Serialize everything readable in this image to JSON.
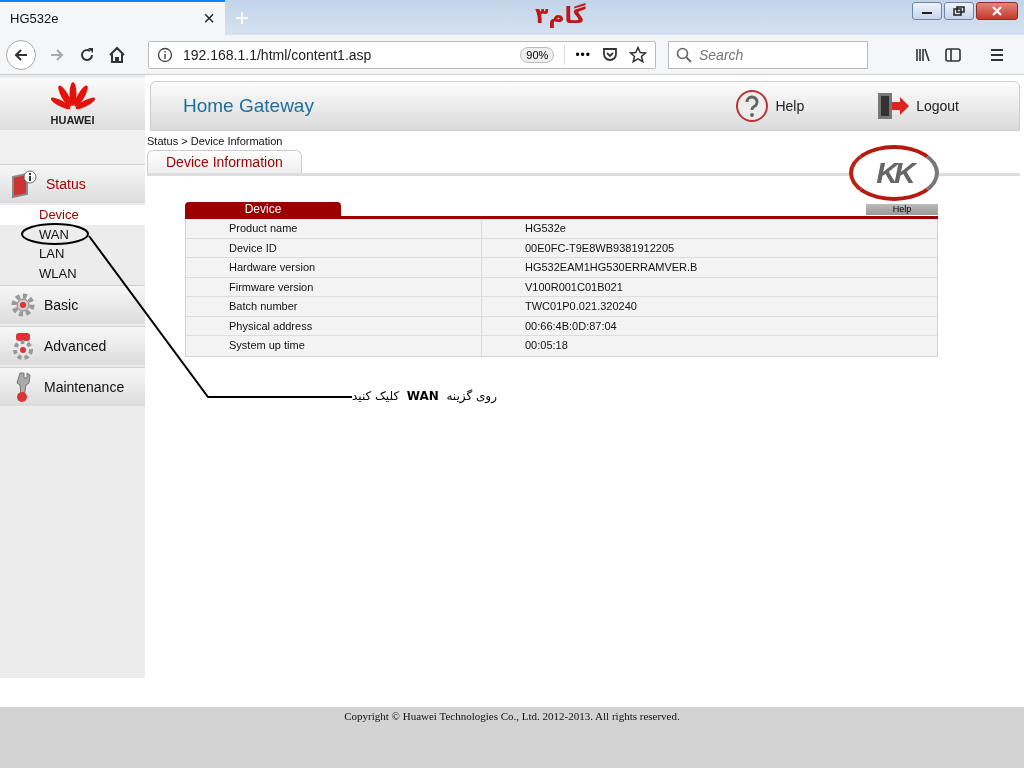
{
  "browser": {
    "tab": {
      "title": "HG532e",
      "close": "×"
    },
    "new_tab": "+",
    "url": "192.168.1.1/html/content1.asp",
    "zoom": "90%",
    "more": "•••",
    "search": {
      "placeholder": "Search"
    }
  },
  "overlay_title": "گام۳",
  "sidebar": {
    "logo_text": "HUAWEI",
    "sections": [
      {
        "label": "Status",
        "selected": true,
        "expanded": true,
        "children": [
          {
            "label": "Device",
            "selected": true
          },
          {
            "label": "WAN",
            "selected": false
          },
          {
            "label": "LAN",
            "selected": false
          },
          {
            "label": "WLAN",
            "selected": false
          }
        ]
      },
      {
        "label": "Basic",
        "selected": false,
        "expanded": false
      },
      {
        "label": "Advanced",
        "selected": false,
        "expanded": false
      },
      {
        "label": "Maintenance",
        "selected": false,
        "expanded": false
      }
    ]
  },
  "header": {
    "title": "Home Gateway",
    "help": "Help",
    "logout": "Logout"
  },
  "breadcrumb": "Status > Device Information",
  "tabs": [
    {
      "label": "Device Information",
      "selected": true
    }
  ],
  "corner_logo": "KK",
  "device_table": {
    "title": "Device",
    "help": "Help",
    "rows": [
      {
        "label": "Product name",
        "value": "HG532e"
      },
      {
        "label": "Device ID",
        "value": "00E0FC-T9E8WB9381912205"
      },
      {
        "label": "Hardware version",
        "value": "HG532EAM1HG530ERRAMVER.B"
      },
      {
        "label": "Firmware version",
        "value": "V100R001C01B021"
      },
      {
        "label": "Batch number",
        "value": "TWC01P0.021.320240"
      },
      {
        "label": "Physical address",
        "value": "00:66:4B:0D:87:04"
      },
      {
        "label": "System up time",
        "value": "00:05:18"
      }
    ]
  },
  "annotation": {
    "text": "روی گزینه  **WAN**  کلیک کنید"
  },
  "footer": {
    "copyright": "Copyright © Huawei Technologies Co., Ltd. 2012-2013. All rights reserved."
  }
}
